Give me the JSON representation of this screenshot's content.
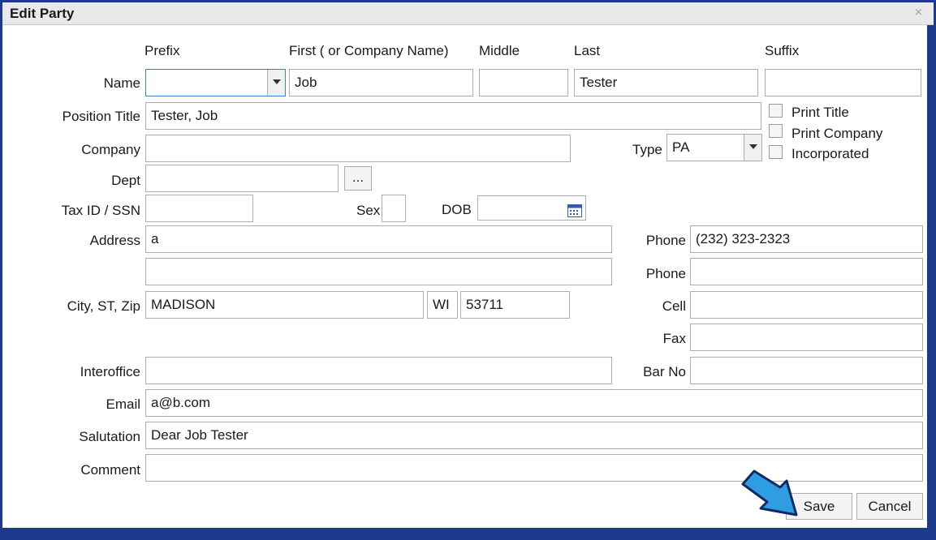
{
  "window": {
    "title": "Edit Party",
    "close_icon": "close-icon"
  },
  "headers": {
    "prefix": "Prefix",
    "first": "First ( or Company Name)",
    "middle": "Middle",
    "last": "Last",
    "suffix": "Suffix"
  },
  "labels": {
    "name": "Name",
    "position_title": "Position Title",
    "company": "Company",
    "dept": "Dept",
    "tax_id": "Tax ID / SSN",
    "sex": "Sex",
    "dob": "DOB",
    "address": "Address",
    "city_st_zip": "City, ST, Zip",
    "interoffice": "Interoffice",
    "email": "Email",
    "salutation": "Salutation",
    "comment": "Comment",
    "type": "Type",
    "phone1": "Phone",
    "phone2": "Phone",
    "cell": "Cell",
    "fax": "Fax",
    "bar_no": "Bar No"
  },
  "values": {
    "prefix": "",
    "first": "Job",
    "middle": "",
    "last": "Tester",
    "suffix": "",
    "position_title": "Tester, Job",
    "company": "",
    "dept": "",
    "tax_id": "",
    "sex": "",
    "dob": "",
    "address1": "a",
    "address2": "",
    "city": "MADISON",
    "state": "WI",
    "zip": "53711",
    "interoffice": "",
    "email": "a@b.com",
    "salutation": "Dear Job Tester",
    "comment": "",
    "type": "PA",
    "phone1": "(232) 323-2323",
    "phone2": "",
    "cell": "",
    "fax": "",
    "bar_no": ""
  },
  "checkboxes": {
    "print_title": "Print Title",
    "print_company": "Print Company",
    "incorporated": "Incorporated"
  },
  "buttons": {
    "dept_browse": "...",
    "save": "Save",
    "cancel": "Cancel"
  },
  "colors": {
    "frame": "#1b3a8c",
    "arrow": "#2f9ee0",
    "focus_border": "#3e7fd0"
  }
}
